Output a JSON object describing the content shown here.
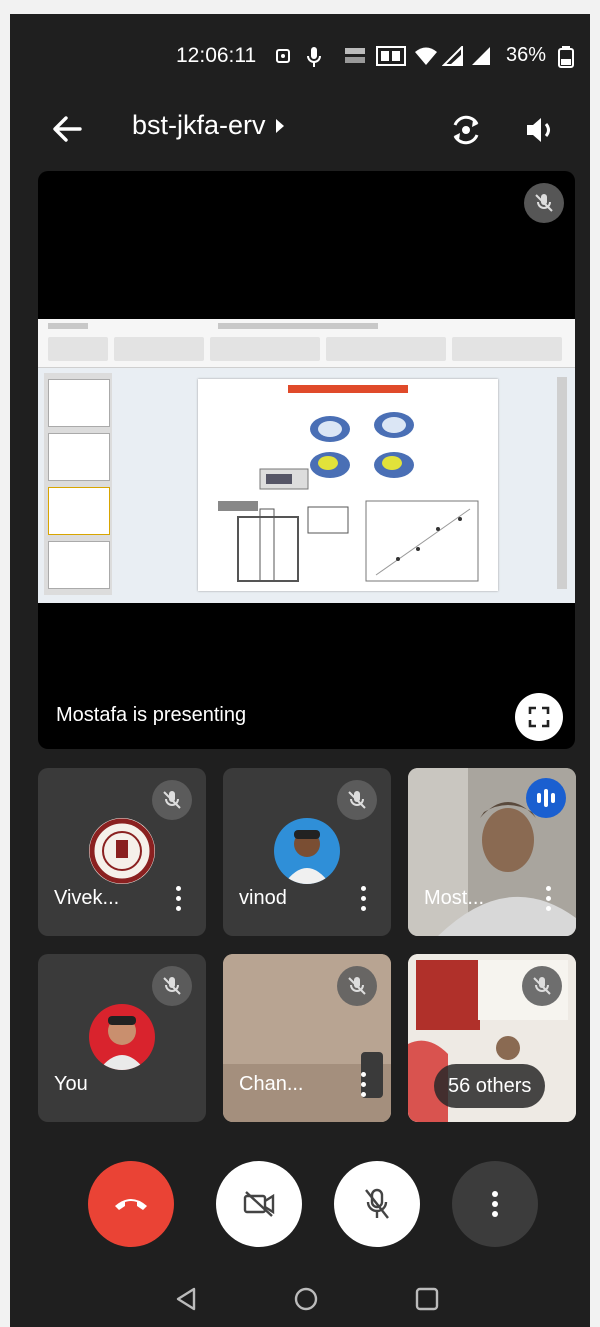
{
  "status_bar": {
    "time": "12:06:11",
    "battery_percent": "36%",
    "icons": [
      "screen-record-icon",
      "mic-icon",
      "speed-icon",
      "hd-icon",
      "wifi-icon",
      "signal-icon",
      "signal-icon",
      "battery-icon"
    ]
  },
  "header": {
    "meeting_code": "bst-jkfa-erv"
  },
  "presentation": {
    "presenting_label": "Mostafa is presenting"
  },
  "participants": [
    {
      "name": "Vivek...",
      "muted": true
    },
    {
      "name": "vinod",
      "muted": true
    },
    {
      "name": "Most...",
      "muted": false,
      "speaking": true
    },
    {
      "name": "You",
      "muted": true
    },
    {
      "name": "Chan...",
      "muted": true
    },
    {
      "name": "",
      "muted": true,
      "others_label": "56 others"
    }
  ],
  "colors": {
    "end_call": "#ea4335",
    "speaking_badge": "#1a5fd0",
    "background": "#1f1f1f"
  }
}
